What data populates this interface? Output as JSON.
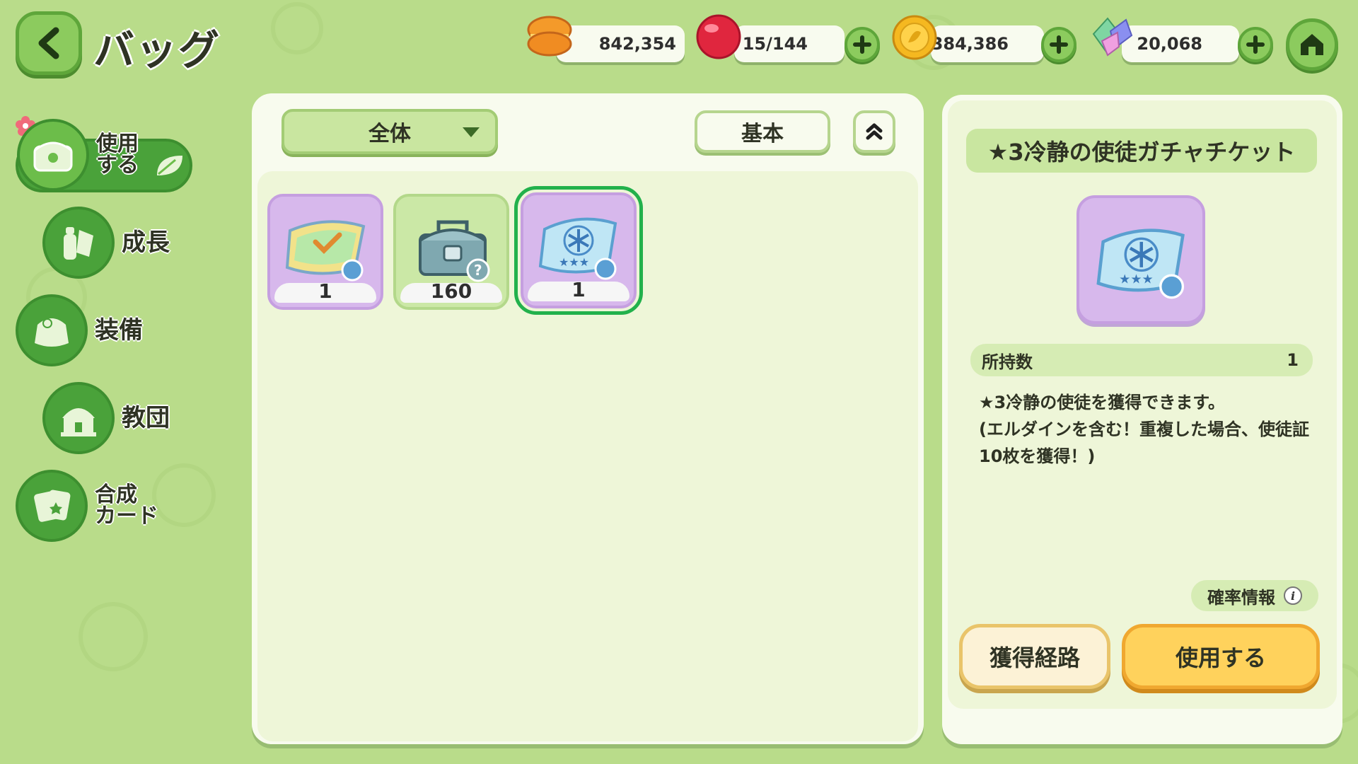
{
  "header": {
    "title": "バッグ",
    "back_icon": "chevron-left-icon",
    "home_icon": "home-icon"
  },
  "currencies": [
    {
      "name": "macaron",
      "icon": "macaron-icon",
      "value": "842,354",
      "has_plus": false
    },
    {
      "name": "stamina",
      "icon": "red-gem-icon",
      "value": "15/144",
      "has_plus": true
    },
    {
      "name": "gold",
      "icon": "gold-coin-icon",
      "value": "384,386",
      "has_plus": true
    },
    {
      "name": "crystal",
      "icon": "rainbow-crystal-icon",
      "value": "20,068",
      "has_plus": true
    }
  ],
  "sidebar": {
    "items": [
      {
        "label": "使用\nする",
        "icon": "chest-icon",
        "active": true
      },
      {
        "label": "成長",
        "icon": "potion-icon",
        "active": false
      },
      {
        "label": "装備",
        "icon": "armor-icon",
        "active": false
      },
      {
        "label": "教団",
        "icon": "temple-icon",
        "active": false
      },
      {
        "label": "合成\nカード",
        "icon": "card-icon",
        "active": false
      }
    ]
  },
  "inventory": {
    "filter_label": "全体",
    "sort_label": "基本",
    "items": [
      {
        "name": "rainbow-ticket",
        "count": "1",
        "bg": "purple"
      },
      {
        "name": "mystery-chest",
        "count": "160",
        "bg": "green"
      },
      {
        "name": "ice-gacha-ticket",
        "count": "1",
        "bg": "purple",
        "selected": true
      }
    ]
  },
  "detail": {
    "title": "★3冷静の使徒ガチャチケット",
    "owned_label": "所持数",
    "owned_value": "1",
    "description": "★3冷静の使徒を獲得できます。\n(エルダインを含む！重複した場合、使徒証10枚を獲得！)",
    "prob_label": "確率情報",
    "route_button": "獲得経路",
    "use_button": "使用する"
  },
  "colors": {
    "background": "#b9dc8a",
    "accent_green": "#4aa23a",
    "use_button": "#ffd25c",
    "selected_outline": "#22b14c"
  }
}
